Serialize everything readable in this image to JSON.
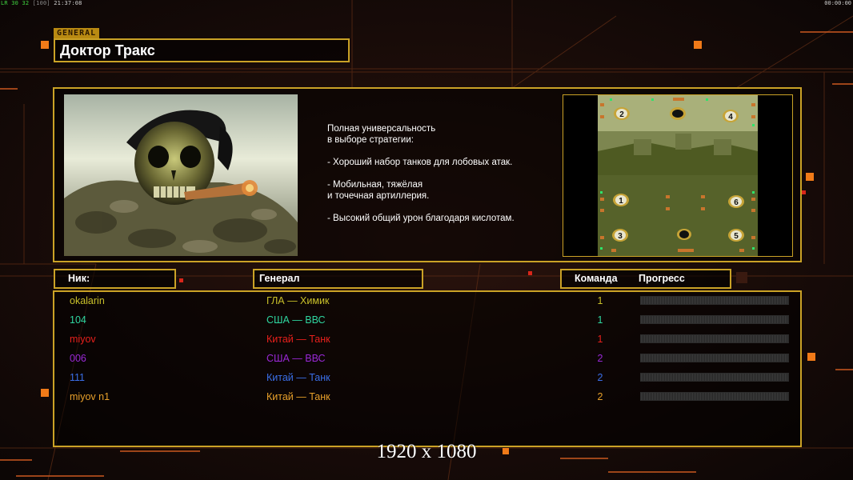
{
  "status": {
    "fps_label": "LR 30 32",
    "counter": "[100]",
    "clock": "21:37:08",
    "timer": "00:00:00"
  },
  "general_tag": "GENERAL",
  "title": "Доктор Тракс",
  "description": {
    "intro": [
      "Полная универсальность",
      "в выборе стратегии:"
    ],
    "points": [
      [
        "- Хороший набор танков для лобовых атак."
      ],
      [
        "- Мобильная, тяжёлая",
        "и точечная артиллерия."
      ],
      [
        "- Высокий общий урон благодаря кислотам."
      ]
    ]
  },
  "map": {
    "start_positions": [
      "1",
      "2",
      "3",
      "4",
      "5",
      "6"
    ]
  },
  "headers": {
    "nick": "Ник:",
    "general": "Генерал",
    "team": "Команда",
    "progress": "Прогресс"
  },
  "players": [
    {
      "nick": "okalarin",
      "general": "ГЛА — Химик",
      "team": "1",
      "color": "#c9c02a",
      "progress": 0
    },
    {
      "nick": "104",
      "general": "США — ВВС",
      "team": "1",
      "color": "#2fd6a0",
      "progress": 0
    },
    {
      "nick": "miyov",
      "general": "Китай — Танк",
      "team": "1",
      "color": "#e8201c",
      "progress": 0
    },
    {
      "nick": "006",
      "general": "США — ВВС",
      "team": "2",
      "color": "#9a28d6",
      "progress": 0
    },
    {
      "nick": "111",
      "general": "Китай — Танк",
      "team": "2",
      "color": "#3a6fe8",
      "progress": 0
    },
    {
      "nick": "miyov n1",
      "general": "Китай — Танк",
      "team": "2",
      "color": "#e8a02a",
      "progress": 0
    }
  ],
  "resolution_label": "1920 x 1080",
  "colors": {
    "accent": "#caa226",
    "background": "#140a08"
  }
}
